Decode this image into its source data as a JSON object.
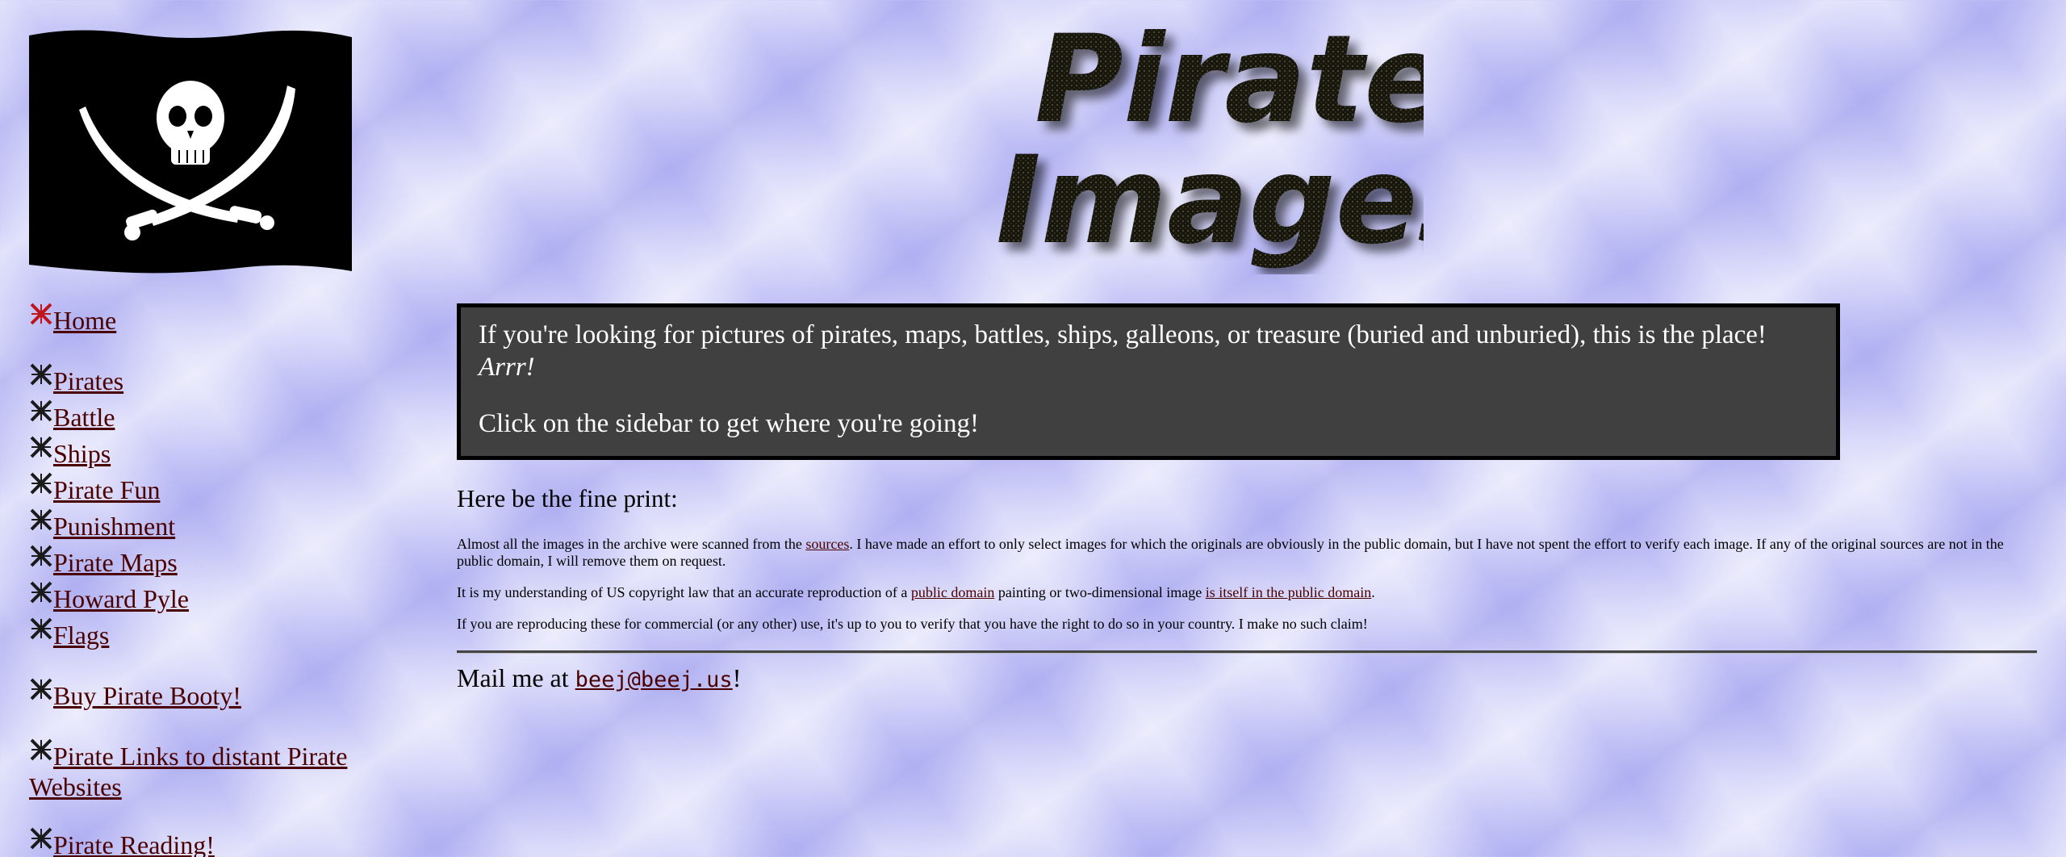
{
  "brand": {
    "flag_icon": "jolly-roger-flag",
    "logo_text_line1": "Pirate",
    "logo_text_line2": "Images"
  },
  "colors": {
    "intro_bg": "#404040",
    "link": "#4a0000",
    "bullet_home": "#c0141c",
    "bullet_other": "#1a1a1a"
  },
  "sidebar": {
    "groups": [
      {
        "items": [
          {
            "label": "Home",
            "bullet": "red"
          }
        ]
      },
      {
        "items": [
          {
            "label": "Pirates"
          },
          {
            "label": "Battle"
          },
          {
            "label": "Ships"
          },
          {
            "label": "Pirate Fun"
          },
          {
            "label": "Punishment"
          },
          {
            "label": "Pirate Maps"
          },
          {
            "label": "Howard Pyle"
          },
          {
            "label": "Flags"
          }
        ]
      },
      {
        "items": [
          {
            "label": "Buy Pirate Booty!"
          }
        ]
      },
      {
        "items": [
          {
            "label": "Pirate Links to distant Pirate Websites"
          }
        ]
      },
      {
        "items": [
          {
            "label": "Pirate Reading!"
          }
        ]
      }
    ]
  },
  "intro": {
    "line1": "If you're looking for pictures of pirates, maps, battles, ships, galleons, or treasure (buried and unburied), this is the place! ",
    "line1_em": "Arrr!",
    "line2": "Click on the sidebar to get where you're going!"
  },
  "fineprint": {
    "heading": "Here be the fine print:",
    "p1_a": "Almost all the images in the archive were scanned from the ",
    "p1_link": "sources",
    "p1_b": ". I have made an effort to only select images for which the originals are obviously in the public domain, but I have not spent the effort to verify each image. If any of the original sources are not in the public domain, I will remove them on request.",
    "p2_a": "It is my understanding of US copyright law that an accurate reproduction of a ",
    "p2_link1": "public domain",
    "p2_b": " painting or two-dimensional image ",
    "p2_link2": "is itself in the public domain",
    "p2_c": ".",
    "p3": "If you are reproducing these for commercial (or any other) use, it's up to you to verify that you have the right to do so in your country. I make no such claim!"
  },
  "mail": {
    "prefix": "Mail me at ",
    "email": "beej@beej.us",
    "suffix": "!"
  }
}
